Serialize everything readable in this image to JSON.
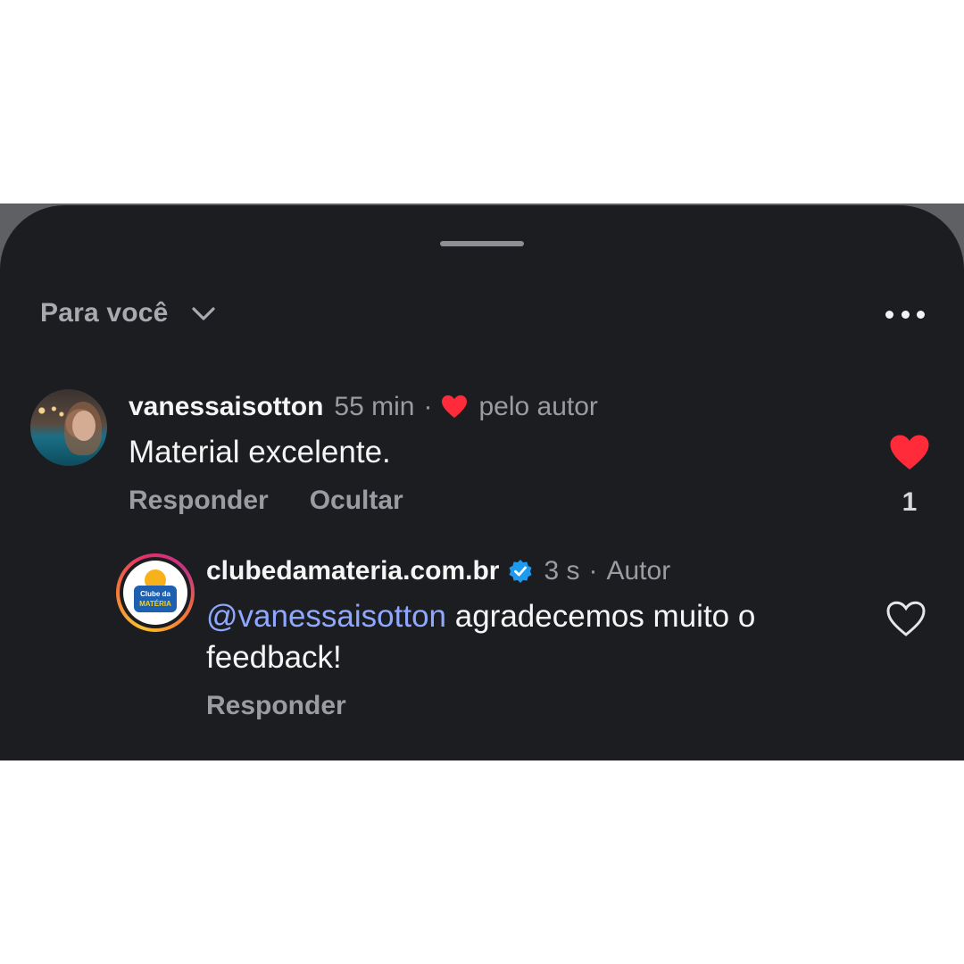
{
  "header": {
    "filter_label": "Para você",
    "more_icon": "more-horizontal-icon"
  },
  "comments": [
    {
      "username": "vanessaisotton",
      "time": "55 min",
      "liked_by_author_label": "pelo autor",
      "text": "Material excelente.",
      "actions": [
        "Responder",
        "Ocultar"
      ],
      "liked": true,
      "like_count": "1"
    }
  ],
  "reply": {
    "username": "clubedamateria.com.br",
    "verified": true,
    "time": "3 s",
    "role": "Autor",
    "mention": "@vanessaisotton",
    "text": "agradecemos muito o feedback!",
    "actions": [
      "Responder"
    ],
    "liked": false,
    "avatar_logo_text": [
      "Clube da",
      "MATÉRIA"
    ]
  },
  "colors": {
    "sheet_bg": "#1c1d21",
    "heart_red": "#ff2a3a",
    "mention_blue": "#8fa8ff",
    "verified_blue": "#1d9bf0"
  }
}
